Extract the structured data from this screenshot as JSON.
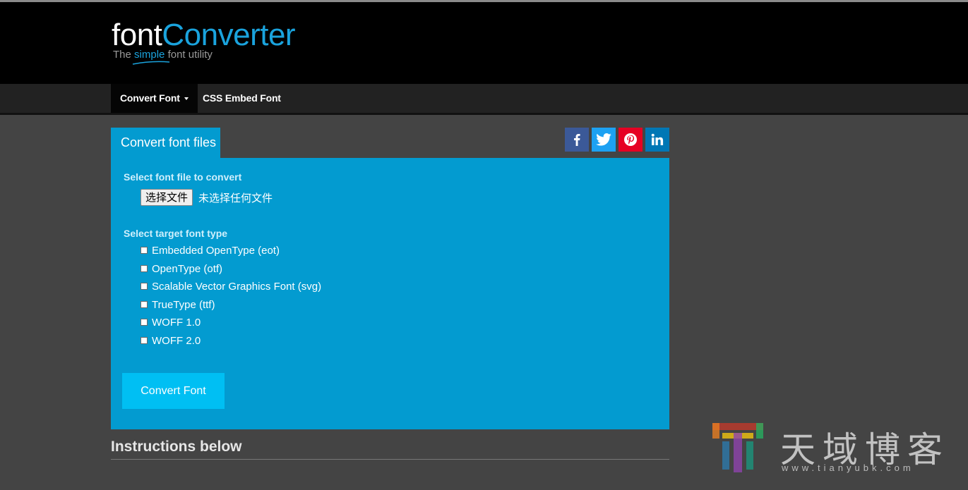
{
  "logo": {
    "word_font": "font",
    "word_converter": "Converter",
    "tagline_the": "The",
    "tagline_simple": "simple",
    "tagline_rest": "font utility"
  },
  "nav": {
    "convert_font": "Convert Font",
    "css_embed_font": "CSS Embed Font"
  },
  "tab": {
    "label": "Convert font files"
  },
  "social": [
    "facebook",
    "twitter",
    "pinterest",
    "linkedin"
  ],
  "form": {
    "select_file_label": "Select font file to convert",
    "file_button": "选择文件",
    "file_status": "未选择任何文件",
    "select_type_label": "Select target font type",
    "options": [
      {
        "label": "Embedded OpenType (eot)",
        "checked": false
      },
      {
        "label": "OpenType (otf)",
        "checked": false
      },
      {
        "label": "Scalable Vector Graphics Font (svg)",
        "checked": false
      },
      {
        "label": "TrueType (ttf)",
        "checked": false
      },
      {
        "label": "WOFF 1.0",
        "checked": false
      },
      {
        "label": "WOFF 2.0",
        "checked": false
      }
    ],
    "convert_button": "Convert Font"
  },
  "instructions": {
    "heading": "Instructions below"
  },
  "watermark": {
    "text": "天域博客",
    "url": "www.tianyubk.com"
  },
  "colors": {
    "accent": "#039bd0",
    "button": "#00bff3",
    "facebook": "#3b5998",
    "twitter": "#1da1f2",
    "pinterest": "#e60023",
    "linkedin": "#0077b5"
  }
}
